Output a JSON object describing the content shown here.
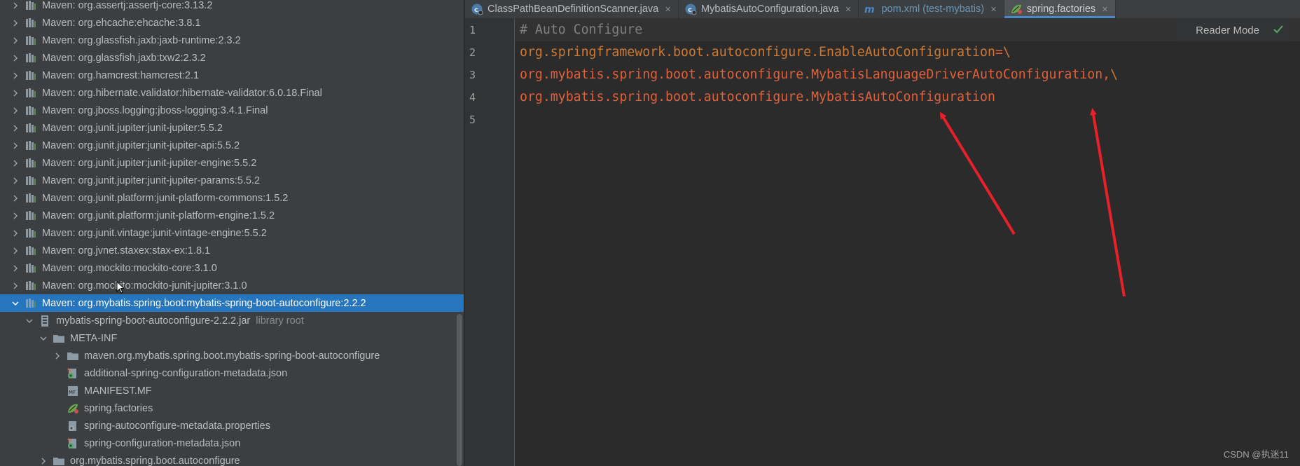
{
  "project_tree": {
    "rows": [
      {
        "label": "Maven: org.assertj:assertj-core:3.13.2",
        "expanded": false,
        "icon": "library-icon"
      },
      {
        "label": "Maven: org.ehcache:ehcache:3.8.1",
        "expanded": false,
        "icon": "library-icon"
      },
      {
        "label": "Maven: org.glassfish.jaxb:jaxb-runtime:2.3.2",
        "expanded": false,
        "icon": "library-icon"
      },
      {
        "label": "Maven: org.glassfish.jaxb:txw2:2.3.2",
        "expanded": false,
        "icon": "library-icon"
      },
      {
        "label": "Maven: org.hamcrest:hamcrest:2.1",
        "expanded": false,
        "icon": "library-icon"
      },
      {
        "label": "Maven: org.hibernate.validator:hibernate-validator:6.0.18.Final",
        "expanded": false,
        "icon": "library-icon"
      },
      {
        "label": "Maven: org.jboss.logging:jboss-logging:3.4.1.Final",
        "expanded": false,
        "icon": "library-icon"
      },
      {
        "label": "Maven: org.junit.jupiter:junit-jupiter:5.5.2",
        "expanded": false,
        "icon": "library-icon"
      },
      {
        "label": "Maven: org.junit.jupiter:junit-jupiter-api:5.5.2",
        "expanded": false,
        "icon": "library-icon"
      },
      {
        "label": "Maven: org.junit.jupiter:junit-jupiter-engine:5.5.2",
        "expanded": false,
        "icon": "library-icon"
      },
      {
        "label": "Maven: org.junit.jupiter:junit-jupiter-params:5.5.2",
        "expanded": false,
        "icon": "library-icon"
      },
      {
        "label": "Maven: org.junit.platform:junit-platform-commons:1.5.2",
        "expanded": false,
        "icon": "library-icon"
      },
      {
        "label": "Maven: org.junit.platform:junit-platform-engine:1.5.2",
        "expanded": false,
        "icon": "library-icon"
      },
      {
        "label": "Maven: org.junit.vintage:junit-vintage-engine:5.5.2",
        "expanded": false,
        "icon": "library-icon"
      },
      {
        "label": "Maven: org.jvnet.staxex:stax-ex:1.8.1",
        "expanded": false,
        "icon": "library-icon"
      },
      {
        "label": "Maven: org.mockito:mockito-core:3.1.0",
        "expanded": false,
        "icon": "library-icon"
      },
      {
        "label": "Maven: org.mockito:mockito-junit-jupiter:3.1.0",
        "expanded": false,
        "icon": "library-icon"
      },
      {
        "label": "Maven: org.mybatis.spring.boot:mybatis-spring-boot-autoconfigure:2.2.2",
        "expanded": true,
        "selected": true,
        "icon": "library-icon"
      },
      {
        "label": "mybatis-spring-boot-autoconfigure-2.2.2.jar",
        "suffix": "library root",
        "expanded": true,
        "icon": "jar-icon",
        "depth": 1
      },
      {
        "label": "META-INF",
        "expanded": true,
        "icon": "folder-icon",
        "depth": 2
      },
      {
        "label": "maven.org.mybatis.spring.boot.mybatis-spring-boot-autoconfigure",
        "expanded": false,
        "icon": "folder-icon",
        "depth": 3
      },
      {
        "label": "additional-spring-configuration-metadata.json",
        "icon": "json-config-icon",
        "depth": 3,
        "leaf": true
      },
      {
        "label": "MANIFEST.MF",
        "icon": "manifest-icon",
        "depth": 3,
        "leaf": true
      },
      {
        "label": "spring.factories",
        "icon": "spring-factories-icon",
        "depth": 3,
        "leaf": true
      },
      {
        "label": "spring-autoconfigure-metadata.properties",
        "icon": "properties-icon",
        "depth": 3,
        "leaf": true
      },
      {
        "label": "spring-configuration-metadata.json",
        "icon": "json-config-icon",
        "depth": 3,
        "leaf": true
      },
      {
        "label": "org.mybatis.spring.boot.autoconfigure",
        "expanded": false,
        "icon": "package-icon",
        "depth": 2
      }
    ]
  },
  "tabs": [
    {
      "label": "ClassPathBeanDefinitionScanner.java",
      "icon": "java-class-icon",
      "active": false
    },
    {
      "label": "MybatisAutoConfiguration.java",
      "icon": "java-class-icon",
      "active": false
    },
    {
      "label": "pom.xml (test-mybatis)",
      "icon": "maven-pom-icon",
      "active": false
    },
    {
      "label": "spring.factories",
      "icon": "spring-factories-icon",
      "active": true
    }
  ],
  "editor": {
    "line_numbers": [
      "1",
      "2",
      "3",
      "4",
      "5"
    ],
    "lines": [
      {
        "parts": [
          {
            "text": "# Auto Configure",
            "kind": "comment"
          }
        ]
      },
      {
        "parts": [
          {
            "text": "org.springframework.boot.autoconfigure.EnableAutoConfiguration",
            "kind": "key"
          },
          {
            "text": "=",
            "kind": "val"
          },
          {
            "text": "\\",
            "kind": "esc"
          }
        ]
      },
      {
        "parts": [
          {
            "text": "org.mybatis.spring.boot.autoconfigure.MybatisLanguageDriverAutoConfiguration,",
            "kind": "val"
          },
          {
            "text": "\\",
            "kind": "esc"
          }
        ]
      },
      {
        "parts": [
          {
            "text": "org.mybatis.spring.boot.autoconfigure.MybatisAutoConfiguration",
            "kind": "val"
          }
        ]
      },
      {
        "parts": []
      }
    ],
    "reader_mode_label": "Reader Mode",
    "status_icon": "checkmark-icon"
  },
  "watermark": "CSDN @执迷11",
  "colors": {
    "selection": "#2675bf",
    "comment": "#808080",
    "key": "#cc7832",
    "value": "#e0603a",
    "annotation_arrow": "#e8202a"
  }
}
